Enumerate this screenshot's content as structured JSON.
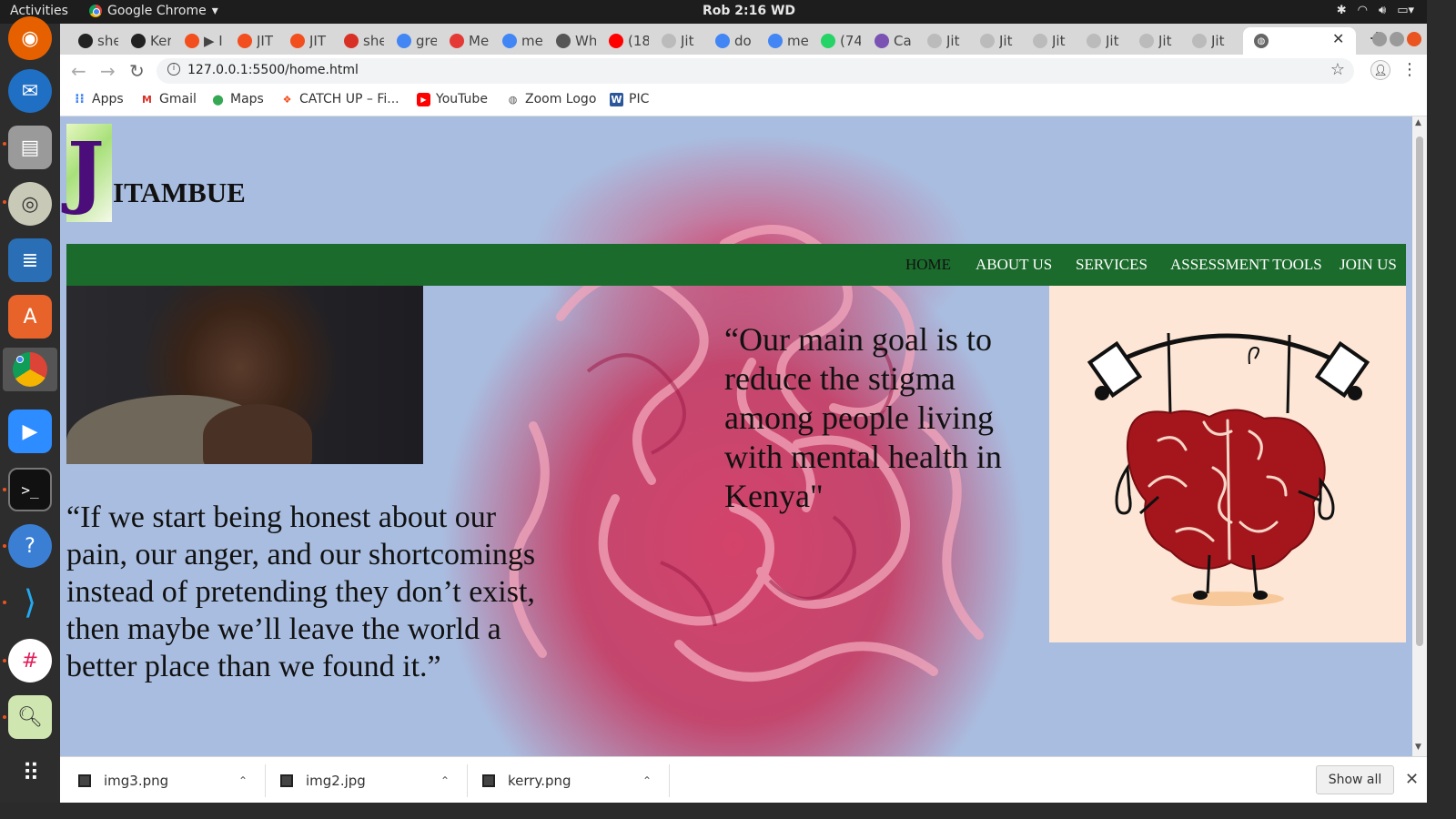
{
  "system": {
    "activities": "Activities",
    "app_name": "Google Chrome",
    "clock": "Rob  2:16 WD"
  },
  "tabs": [
    {
      "label": "she",
      "icon": "github-icon",
      "color": "#222222"
    },
    {
      "label": "Ker",
      "icon": "github-icon",
      "color": "#222222"
    },
    {
      "label": "▶ I",
      "icon": "figma-icon",
      "color": "#f24e1e"
    },
    {
      "label": "JIT",
      "icon": "figma-icon",
      "color": "#f24e1e"
    },
    {
      "label": "JIT",
      "icon": "figma-icon",
      "color": "#f24e1e"
    },
    {
      "label": "she",
      "icon": "gmail-icon",
      "color": "#d93025"
    },
    {
      "label": "gre",
      "icon": "google-icon",
      "color": "#4285f4"
    },
    {
      "label": "Me",
      "icon": "s-icon",
      "color": "#e53935"
    },
    {
      "label": "me",
      "icon": "google-icon",
      "color": "#4285f4"
    },
    {
      "label": "Wh",
      "icon": "eye-icon",
      "color": "#555555"
    },
    {
      "label": "(18",
      "icon": "youtube-icon",
      "color": "#ff0000"
    },
    {
      "label": "Jit",
      "icon": "globe-icon",
      "color": "#bbbbbb"
    },
    {
      "label": "do",
      "icon": "google-icon",
      "color": "#4285f4"
    },
    {
      "label": "me",
      "icon": "google-icon",
      "color": "#4285f4"
    },
    {
      "label": "(74",
      "icon": "whatsapp-icon",
      "color": "#25d366"
    },
    {
      "label": "Ca",
      "icon": "bootstrap-icon",
      "color": "#7952b3"
    },
    {
      "label": "Jit",
      "icon": "globe-icon",
      "color": "#bbbbbb"
    },
    {
      "label": "Jit",
      "icon": "globe-icon",
      "color": "#bbbbbb"
    },
    {
      "label": "Jit",
      "icon": "globe-icon",
      "color": "#bbbbbb"
    },
    {
      "label": "Jit",
      "icon": "globe-icon",
      "color": "#bbbbbb"
    },
    {
      "label": "Jit",
      "icon": "globe-icon",
      "color": "#bbbbbb"
    },
    {
      "label": "Jit",
      "icon": "globe-icon",
      "color": "#bbbbbb"
    }
  ],
  "omnibox": {
    "url": "127.0.0.1:5500/home.html"
  },
  "bookmarks": [
    {
      "label": "Apps",
      "icon": "apps-grid-icon"
    },
    {
      "label": "Gmail",
      "icon": "gmail-icon"
    },
    {
      "label": "Maps",
      "icon": "maps-pin-icon"
    },
    {
      "label": "CATCH UP – Fi...",
      "icon": "figma-icon"
    },
    {
      "label": "YouTube",
      "icon": "youtube-icon"
    },
    {
      "label": "Zoom Logo",
      "icon": "globe-icon"
    },
    {
      "label": "PIC",
      "icon": "word-icon"
    }
  ],
  "site": {
    "logo_initial": "J",
    "logo_rest": "ITAMBUE",
    "nav": [
      "HOME",
      "ABOUT US",
      "SERVICES",
      "ASSESSMENT TOOLS",
      "JOIN US"
    ],
    "quote_left": "“If we start being honest about our pain, our anger, and our shortcomings instead of pretending they don’t exist, then maybe we’ll leave the world a better place than we found it.”",
    "quote_right": "“Our main goal is to reduce the stigma among people living with mental health in Kenya\"",
    "colors": {
      "nav": "#1b6b2c",
      "logo": "#4b0d7a",
      "illustration_bg": "#fde6d6",
      "brain": "#a5161c"
    }
  },
  "downloads": {
    "items": [
      "img3.png",
      "img2.jpg",
      "kerry.png"
    ],
    "show_all": "Show all"
  }
}
